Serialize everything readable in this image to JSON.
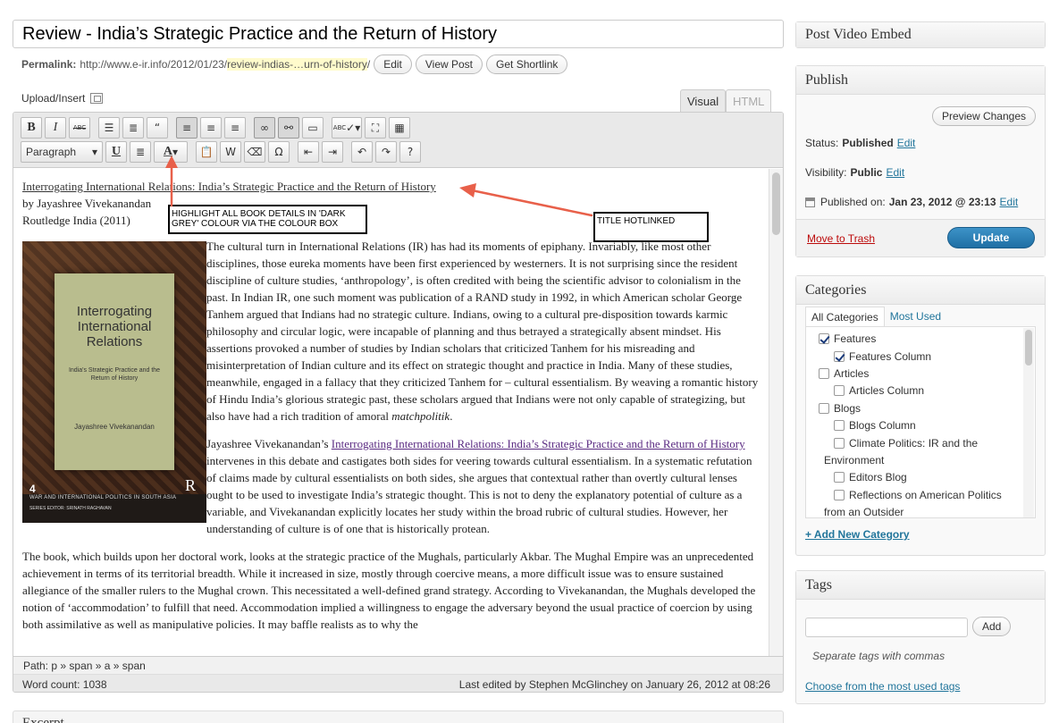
{
  "post": {
    "title": "Review - India’s Strategic Practice and the Return of History",
    "permalink_label": "Permalink:",
    "permalink_base": "http://www.e-ir.info/2012/01/23/",
    "permalink_slug": "review-indias-…urn-of-history",
    "permalink_end": "/",
    "edit_btn": "Edit",
    "view_btn": "View Post",
    "shortlink_btn": "Get Shortlink"
  },
  "editor": {
    "upload_label": "Upload/Insert",
    "tab_visual": "Visual",
    "tab_html": "HTML",
    "format_select": "Paragraph",
    "path_label": "Path:",
    "path_value": "p » span » a » span",
    "word_count": "Word count: 1038",
    "last_edited": "Last edited by Stephen McGlinchey on January 26, 2012 at 08:26",
    "toolbar_icons": [
      "bold-icon",
      "italic-icon",
      "strikethrough-icon",
      "bullet-list-icon",
      "numbered-list-icon",
      "blockquote-icon",
      "align-left-icon",
      "align-center-icon",
      "align-right-icon",
      "link-icon",
      "unlink-icon",
      "more-tag-icon",
      "spellcheck-icon",
      "fullscreen-icon",
      "kitchen-sink-icon",
      "underline-icon",
      "justify-icon",
      "text-color-icon",
      "paste-text-icon",
      "paste-word-icon",
      "remove-format-icon",
      "special-char-icon",
      "outdent-icon",
      "indent-icon",
      "undo-icon",
      "redo-icon",
      "help-icon"
    ]
  },
  "content": {
    "book_title_link": "Interrogating International Relations: India’s Strategic Practice and the Return of History",
    "author_line": "by Jayashree Vivekanandan",
    "publisher_line": "Routledge India (2011)",
    "para1": "The cultural turn in International Relations (IR) has had its moments of epiphany. Invariably, like most other disciplines, those eureka moments have been first experienced by westerners. It is not surprising since the resident discipline of culture studies, ‘anthropology’, is often credited with being the scientific advisor to colonialism in the past. In Indian IR, one such moment was publication of a RAND study in 1992, in which American scholar George Tanhem argued that Indians had no strategic culture. Indians, owing to a cultural pre-disposition towards karmic philosophy and circular logic, were incapable of planning and thus betrayed a strategically absent mindset. His assertions provoked a number of studies by Indian scholars that criticized Tanhem for his misreading and misinterpretation of Indian culture and its effect on strategic thought and practice in India. Many of these studies, meanwhile, engaged in a fallacy that they criticized Tanhem for – cultural essentialism. By weaving a romantic history of Hindu India’s glorious strategic past, these scholars argued that Indians were not only capable of strategizing, but also have had a rich tradition of amoral ",
    "para1_em": "matchpolitik",
    "para1_end": ".",
    "para2_start": "Jayashree Vivekanandan’s ",
    "para2_link": "Interrogating International Relations: India’s Strategic Practice and the Return of History",
    "para2_rest": " intervenes in this debate and castigates both sides for veering towards cultural essentialism. In a systematic refutation of claims made by cultural essentialists on both sides, she argues that contextual rather than overtly cultural lenses ought to be used to investigate India’s strategic thought. This is not to deny the explanatory potential of culture as a variable, and Vivekanandan explicitly locates her study within the broad rubric of cultural studies. However, her understanding of culture is of one that is historically protean.",
    "para3": "The book, which builds upon her doctoral work, looks at the strategic practice of the Mughals, particularly Akbar. The Mughal Empire was an unprecedented achievement in terms of its territorial breadth. While it increased in size, mostly through coercive means, a more difficult issue was to ensure sustained allegiance of the smaller rulers to the Mughal crown. This necessitated a well-defined grand strategy. According to Vivekanandan, the Mughals developed the notion of ‘accommodation’ to fulfill that need.  Accommodation implied a willingness to engage the adversary beyond the usual practice of coercion by using both assimilative as well as manipulative policies. It may baffle realists as to why the"
  },
  "cover": {
    "title": "Interrogating International Relations",
    "subtitle": "India's Strategic Practice and the Return of History",
    "author": "Jayashree Vivekanandan",
    "number": "4",
    "logo": "R",
    "series": "WAR AND INTERNATIONAL POLITICS IN SOUTH ASIA",
    "series_editor": "SERIES EDITOR: SRINATH RAGHAVAN"
  },
  "annotations": {
    "note1": "HIGHLIGHT ALL  BOOK DETAILS IN 'DARK GREY' COLOUR VIA THE COLOUR BOX",
    "note2": "TITLE HOTLINKED",
    "arrow_color": "#e8604a"
  },
  "excerpt": {
    "title": "Excerpt"
  },
  "sidebar": {
    "video_title": "Post Video Embed",
    "publish": {
      "title": "Publish",
      "preview_btn": "Preview Changes",
      "status_label": "Status:",
      "status_value": "Published",
      "visibility_label": "Visibility:",
      "visibility_value": "Public",
      "published_label": "Published on:",
      "published_value": "Jan 23, 2012 @ 23:13",
      "edit": "Edit",
      "trash": "Move to Trash",
      "update": "Update"
    },
    "categories": {
      "title": "Categories",
      "tab_all": "All Categories",
      "tab_used": "Most Used",
      "add_new": "+ Add New Category",
      "items": [
        {
          "label": "Features",
          "checked": true
        },
        {
          "label": "Features Column",
          "checked": true
        },
        {
          "label": "Articles",
          "checked": false
        },
        {
          "label": "Articles Column",
          "checked": false
        },
        {
          "label": "Blogs",
          "checked": false
        },
        {
          "label": "Blogs Column",
          "checked": false
        },
        {
          "label": "Climate Politics: IR and the",
          "label2": "Environment",
          "checked": false
        },
        {
          "label": "Editors Blog",
          "checked": false
        },
        {
          "label": "Reflections on American Politics",
          "label2": "from an Outsider",
          "checked": false
        }
      ]
    },
    "tags": {
      "title": "Tags",
      "add_btn": "Add",
      "hint": "Separate tags with commas",
      "choose": "Choose from the most used tags"
    }
  },
  "colors": {
    "link_blue": "#21759b",
    "update_blue": "#2a7fb8",
    "trash_red": "#bc0b0b",
    "visited_purple": "#5a2a82"
  }
}
